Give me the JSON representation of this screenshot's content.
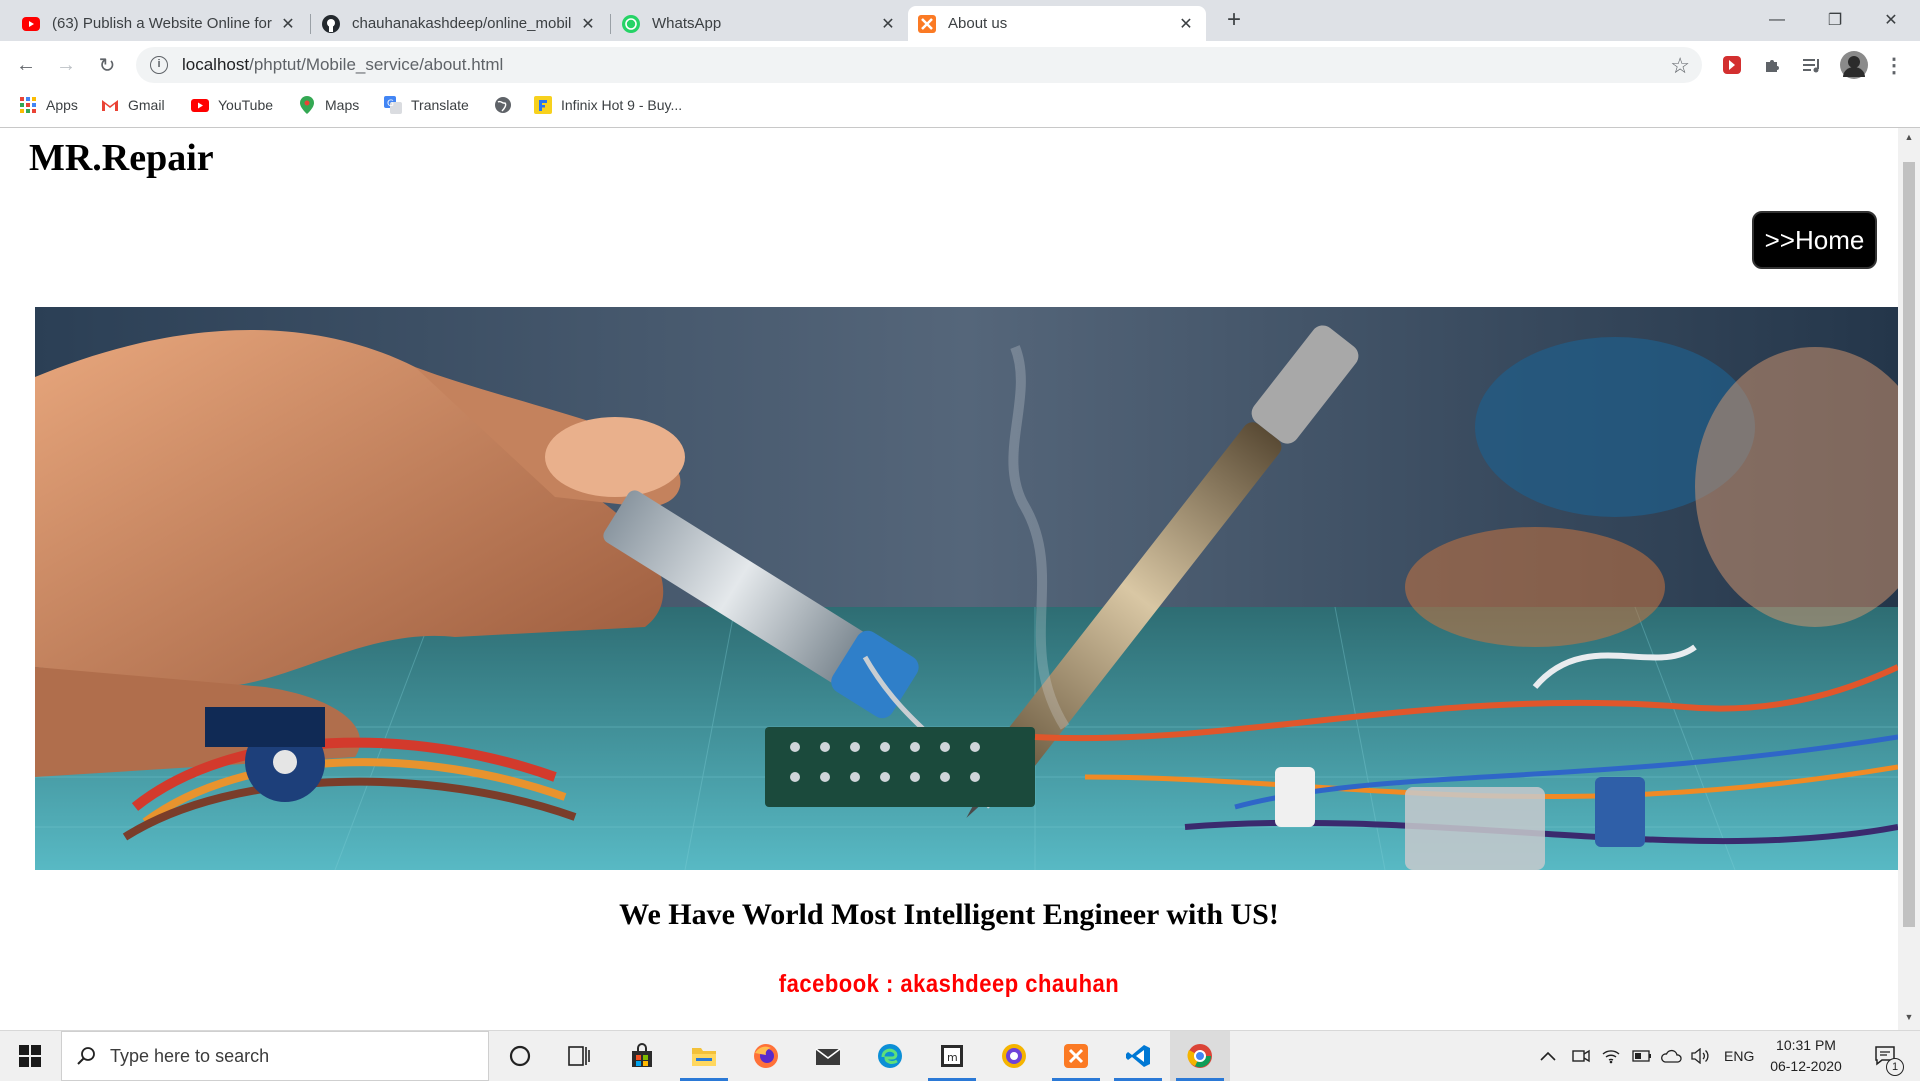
{
  "browser": {
    "tabs": [
      {
        "title": "(63) Publish a Website Online for",
        "icon": "youtube-icon"
      },
      {
        "title": "chauhanakashdeep/online_mobil",
        "icon": "github-icon"
      },
      {
        "title": "WhatsApp",
        "icon": "whatsapp-icon"
      },
      {
        "title": "About us",
        "icon": "xampp-icon",
        "active": true
      }
    ],
    "address": {
      "host": "localhost",
      "path": "/phptut/Mobile_service/about.html"
    },
    "bookmarks": [
      "Apps",
      "Gmail",
      "YouTube",
      "Maps",
      "Translate",
      "",
      "Infinix Hot 9 - Buy..."
    ]
  },
  "page": {
    "brand": "MR.Repair",
    "home_button": ">>Home",
    "hero_alt": "electronics repair soldering",
    "tagline": "We Have World Most Intelligent Engineer with US!",
    "facebook": "facebook : akashdeep chauhan"
  },
  "taskbar": {
    "search_placeholder": "Type here to search",
    "language": "ENG",
    "time": "10:31 PM",
    "date": "06-12-2020",
    "notification_count": "1"
  },
  "colors": {
    "accent_red": "#ff0000",
    "button_bg": "#000000",
    "tab_strip": "#dee1e6"
  }
}
